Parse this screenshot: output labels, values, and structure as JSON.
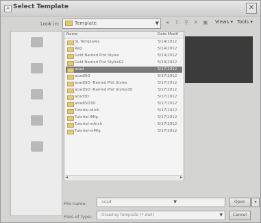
{
  "window": {
    "title": "Select Template"
  },
  "look_in": {
    "label": "Look in:",
    "value": "Template"
  },
  "toolbar": {
    "views_label": "Views",
    "tools_label": "Tools"
  },
  "places": [
    {
      "name": "place-my-recent-documents"
    },
    {
      "name": "place-desktop"
    },
    {
      "name": "place-my-documents"
    },
    {
      "name": "place-my-computer"
    },
    {
      "name": "place-my-network-places"
    }
  ],
  "file_list": {
    "headers": {
      "name": "Name",
      "date": "Date Modif"
    },
    "rows": [
      {
        "name": "SL Templates",
        "date": "5/14/2012"
      },
      {
        "name": "Reg",
        "date": "5/14/2012"
      },
      {
        "name": "Gold Named Plot Styles",
        "date": "5/14/2012"
      },
      {
        "name": "Gold Named Plot Styles02",
        "date": "5/14/2012"
      },
      {
        "name": "acad",
        "date": "5/17/2012"
      },
      {
        "name": "acadISO",
        "date": "5/17/2012"
      },
      {
        "name": "acadISO -Named Plot Styles",
        "date": "5/17/2012"
      },
      {
        "name": "acadISO -Named Plot Styles3D",
        "date": "5/17/2012"
      },
      {
        "name": "acad3D",
        "date": "5/17/2012"
      },
      {
        "name": "acadISO3D",
        "date": "5/17/2012"
      },
      {
        "name": "Tutorial-iArch",
        "date": "5/17/2012"
      },
      {
        "name": "Tutorial-iMfg",
        "date": "5/17/2012"
      },
      {
        "name": "Tutorial-mArch",
        "date": "5/17/2012"
      },
      {
        "name": "Tutorial-mMfg",
        "date": "5/17/2012"
      }
    ],
    "selected_index": 4
  },
  "file_name": {
    "label": "File name:",
    "value": "acad"
  },
  "files_of_type": {
    "label": "Files of type:",
    "value": "Drawing Template (*.dwt)"
  },
  "buttons": {
    "open": "Open",
    "cancel": "Cancel"
  },
  "colors": {
    "selection": "#7a7a7a",
    "preview_bg": "#3b3b3b"
  }
}
